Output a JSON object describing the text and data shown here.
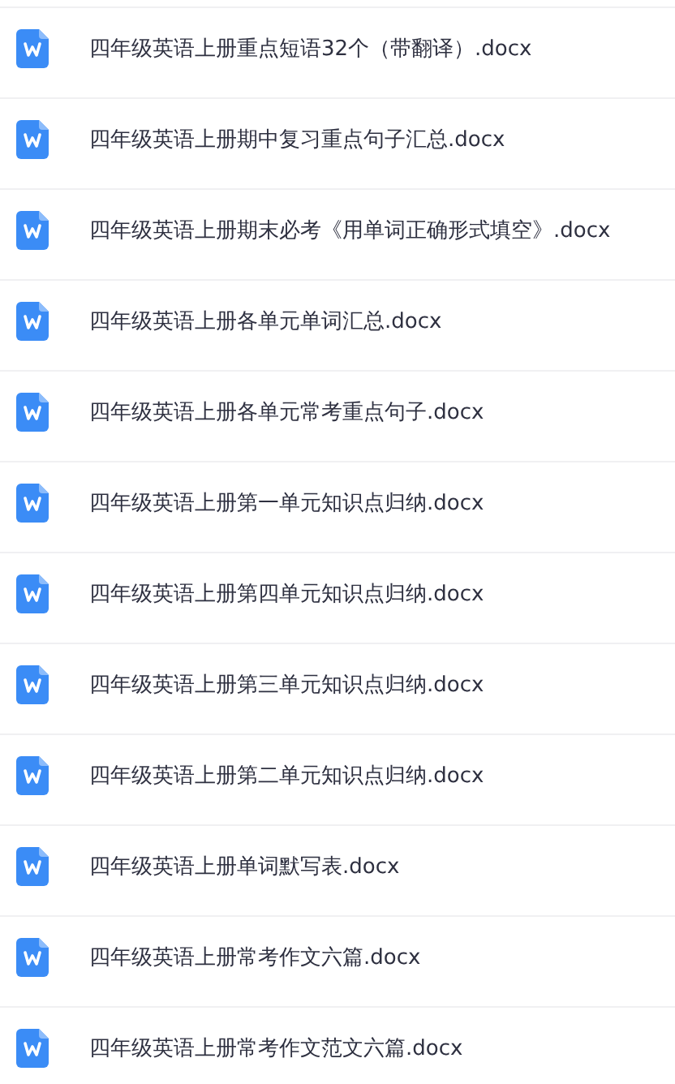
{
  "files": [
    {
      "name": "四年级英语上册重点短语32个（带翻译）.docx"
    },
    {
      "name": "四年级英语上册期中复习重点句子汇总.docx"
    },
    {
      "name": "四年级英语上册期末必考《用单词正确形式填空》.docx"
    },
    {
      "name": "四年级英语上册各单元单词汇总.docx"
    },
    {
      "name": "四年级英语上册各单元常考重点句子.docx"
    },
    {
      "name": "四年级英语上册第一单元知识点归纳.docx"
    },
    {
      "name": "四年级英语上册第四单元知识点归纳.docx"
    },
    {
      "name": "四年级英语上册第三单元知识点归纳.docx"
    },
    {
      "name": "四年级英语上册第二单元知识点归纳.docx"
    },
    {
      "name": "四年级英语上册单词默写表.docx"
    },
    {
      "name": "四年级英语上册常考作文六篇.docx"
    },
    {
      "name": "四年级英语上册常考作文范文六篇.docx"
    }
  ]
}
